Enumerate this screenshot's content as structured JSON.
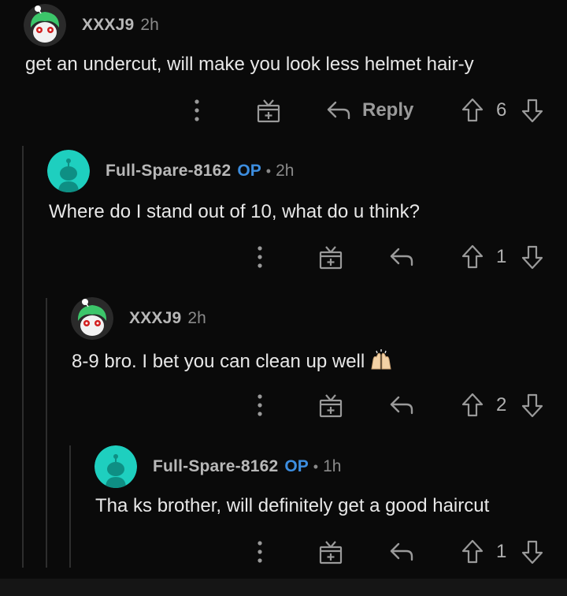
{
  "comments": [
    {
      "username": "XXXJ9",
      "op": "",
      "time": "2h",
      "text": "get an undercut, will make you look less helmet hair-y",
      "reply_label": "Reply",
      "votes": "6",
      "avatar": "green-hair-snoo-avatar"
    },
    {
      "username": "Full-Spare-8162",
      "op": "OP",
      "separator": "•",
      "time": "2h",
      "text": "Where do I stand out of 10, what do u think?",
      "votes": "1",
      "avatar": "default-teal-snoo-avatar"
    },
    {
      "username": "XXXJ9",
      "op": "",
      "time": "2h",
      "text": "8-9 bro. I bet you can clean up well",
      "votes": "2",
      "avatar": "green-hair-snoo-avatar",
      "emoji": "raising-hands-emoji"
    },
    {
      "username": "Full-Spare-8162",
      "op": "OP",
      "separator": "•",
      "time": "1h",
      "text": "Tha ks brother, will definitely get a good haircut",
      "votes": "1",
      "avatar": "default-teal-snoo-avatar"
    }
  ],
  "colors": {
    "background": "#0a0a0a",
    "op_blue": "#3d8ee0",
    "teal_avatar": "#1ecfbf",
    "green_hair": "#3cc66a"
  }
}
